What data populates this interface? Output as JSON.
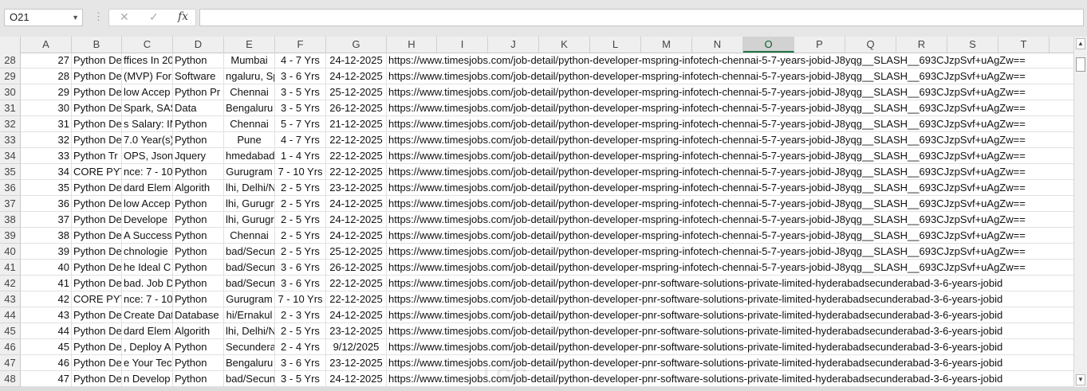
{
  "formula_bar": {
    "name_box": "O21",
    "cancel_icon": "✕",
    "enter_icon": "✓",
    "fx_label": "fx",
    "formula": ""
  },
  "columns": [
    "A",
    "B",
    "C",
    "D",
    "E",
    "F",
    "G",
    "H",
    "I",
    "J",
    "K",
    "L",
    "M",
    "N",
    "O",
    "P",
    "Q",
    "R",
    "S",
    "T"
  ],
  "selected_column": "O",
  "rows": [
    {
      "n": "28",
      "a": "27",
      "b": "Python De",
      "c": "ffices In 20",
      "d": "Python",
      "e": "Mumbai",
      "f": "4 - 7 Yrs",
      "g": "24-12-2025",
      "h": "https://www.timesjobs.com/job-detail/python-developer-mspring-infotech-chennai-5-7-years-jobid-J8yqg__SLASH__693CJzpSvf+uAgZw=="
    },
    {
      "n": "29",
      "a": "28",
      "b": "Python De",
      "c": "(MVP) For",
      "d": "Software",
      "e": "ngaluru, Sp",
      "f": "3 - 6 Yrs",
      "g": "24-12-2025",
      "h": "https://www.timesjobs.com/job-detail/python-developer-mspring-infotech-chennai-5-7-years-jobid-J8yqg__SLASH__693CJzpSvf+uAgZw=="
    },
    {
      "n": "30",
      "a": "29",
      "b": "Python De",
      "c": "low Accep",
      "d": "Python Pr",
      "e": "Chennai",
      "f": "3 - 5 Yrs",
      "g": "25-12-2025",
      "h": "https://www.timesjobs.com/job-detail/python-developer-mspring-infotech-chennai-5-7-years-jobid-J8yqg__SLASH__693CJzpSvf+uAgZw=="
    },
    {
      "n": "31",
      "a": "30",
      "b": "Python De",
      "c": "Spark, SAS",
      "d": "Data",
      "e": "Bengaluru",
      "f": "3 - 5 Yrs",
      "g": "26-12-2025",
      "h": "https://www.timesjobs.com/job-detail/python-developer-mspring-infotech-chennai-5-7-years-jobid-J8yqg__SLASH__693CJzpSvf+uAgZw=="
    },
    {
      "n": "32",
      "a": "31",
      "b": "Python De",
      "c": "s Salary: IN",
      "d": "Python",
      "e": "Chennai",
      "f": "5 - 7 Yrs",
      "g": "21-12-2025",
      "h": "https://www.timesjobs.com/job-detail/python-developer-mspring-infotech-chennai-5-7-years-jobid-J8yqg__SLASH__693CJzpSvf+uAgZw=="
    },
    {
      "n": "33",
      "a": "32",
      "b": "Python De",
      "c": "7.0 Year(s)",
      "d": "Python",
      "e": "Pune",
      "f": "4 - 7 Yrs",
      "g": "22-12-2025",
      "h": "https://www.timesjobs.com/job-detail/python-developer-mspring-infotech-chennai-5-7-years-jobid-J8yqg__SLASH__693CJzpSvf+uAgZw=="
    },
    {
      "n": "34",
      "a": "33",
      "b": "Python Tr",
      "c": "OPS, Json,",
      "d": "Jquery",
      "e": "hmedabad",
      "f": "1 - 4 Yrs",
      "g": "22-12-2025",
      "h": "https://www.timesjobs.com/job-detail/python-developer-mspring-infotech-chennai-5-7-years-jobid-J8yqg__SLASH__693CJzpSvf+uAgZw=="
    },
    {
      "n": "35",
      "a": "34",
      "b": "CORE PYTH",
      "c": "nce: 7 - 10",
      "d": "Python",
      "e": "Gurugram",
      "f": "7 - 10 Yrs",
      "g": "22-12-2025",
      "h": "https://www.timesjobs.com/job-detail/python-developer-mspring-infotech-chennai-5-7-years-jobid-J8yqg__SLASH__693CJzpSvf+uAgZw=="
    },
    {
      "n": "36",
      "a": "35",
      "b": "Python De",
      "c": "dard Elem",
      "d": "Algorith",
      "e": "lhi, Delhi/N",
      "f": "2 - 5 Yrs",
      "g": "23-12-2025",
      "h": "https://www.timesjobs.com/job-detail/python-developer-mspring-infotech-chennai-5-7-years-jobid-J8yqg__SLASH__693CJzpSvf+uAgZw=="
    },
    {
      "n": "37",
      "a": "36",
      "b": "Python De",
      "c": "low Accep",
      "d": "Python",
      "e": "lhi, Gurugr",
      "f": "2 - 5 Yrs",
      "g": "24-12-2025",
      "h": "https://www.timesjobs.com/job-detail/python-developer-mspring-infotech-chennai-5-7-years-jobid-J8yqg__SLASH__693CJzpSvf+uAgZw=="
    },
    {
      "n": "38",
      "a": "37",
      "b": "Python De",
      "c": "Develope",
      "d": "Python",
      "e": "lhi, Gurugr",
      "f": "2 - 5 Yrs",
      "g": "24-12-2025",
      "h": "https://www.timesjobs.com/job-detail/python-developer-mspring-infotech-chennai-5-7-years-jobid-J8yqg__SLASH__693CJzpSvf+uAgZw=="
    },
    {
      "n": "39",
      "a": "38",
      "b": "Python De",
      "c": "A Success",
      "d": "Python",
      "e": "Chennai",
      "f": "2 - 5 Yrs",
      "g": "24-12-2025",
      "h": "https://www.timesjobs.com/job-detail/python-developer-mspring-infotech-chennai-5-7-years-jobid-J8yqg__SLASH__693CJzpSvf+uAgZw=="
    },
    {
      "n": "40",
      "a": "39",
      "b": "Python De",
      "c": "chnologie",
      "d": "Python",
      "e": "bad/Secun",
      "f": "2 - 5 Yrs",
      "g": "25-12-2025",
      "h": "https://www.timesjobs.com/job-detail/python-developer-mspring-infotech-chennai-5-7-years-jobid-J8yqg__SLASH__693CJzpSvf+uAgZw=="
    },
    {
      "n": "41",
      "a": "40",
      "b": "Python De",
      "c": "he Ideal C",
      "d": "Python",
      "e": "bad/Secun",
      "f": "3 - 6 Yrs",
      "g": "26-12-2025",
      "h": "https://www.timesjobs.com/job-detail/python-developer-mspring-infotech-chennai-5-7-years-jobid-J8yqg__SLASH__693CJzpSvf+uAgZw=="
    },
    {
      "n": "42",
      "a": "41",
      "b": "Python De",
      "c": "bad. Job D",
      "d": "Python",
      "e": "bad/Secun",
      "f": "3 - 6 Yrs",
      "g": "22-12-2025",
      "h": "https://www.timesjobs.com/job-detail/python-developer-pnr-software-solutions-private-limited-hyderabadsecunderabad-3-6-years-jobid"
    },
    {
      "n": "43",
      "a": "42",
      "b": "CORE PYTH",
      "c": "nce: 7 - 10",
      "d": "Python",
      "e": "Gurugram",
      "f": "7 - 10 Yrs",
      "g": "22-12-2025",
      "h": "https://www.timesjobs.com/job-detail/python-developer-pnr-software-solutions-private-limited-hyderabadsecunderabad-3-6-years-jobid"
    },
    {
      "n": "44",
      "a": "43",
      "b": "Python De",
      "c": "Create Dat",
      "d": "Database",
      "e": "hi/Ernakul",
      "f": "2 - 3 Yrs",
      "g": "24-12-2025",
      "h": "https://www.timesjobs.com/job-detail/python-developer-pnr-software-solutions-private-limited-hyderabadsecunderabad-3-6-years-jobid"
    },
    {
      "n": "45",
      "a": "44",
      "b": "Python De",
      "c": "dard Elem",
      "d": "Algorith",
      "e": "lhi, Delhi/N",
      "f": "2 - 5 Yrs",
      "g": "23-12-2025",
      "h": "https://www.timesjobs.com/job-detail/python-developer-pnr-software-solutions-private-limited-hyderabadsecunderabad-3-6-years-jobid"
    },
    {
      "n": "46",
      "a": "45",
      "b": "Python De",
      "c": ", Deploy A",
      "d": "Python",
      "e": "Secunderal",
      "f": "2 - 4 Yrs",
      "g": "9/12/2025",
      "h": "https://www.timesjobs.com/job-detail/python-developer-pnr-software-solutions-private-limited-hyderabadsecunderabad-3-6-years-jobid"
    },
    {
      "n": "47",
      "a": "46",
      "b": "Python De",
      "c": "e Your Tec",
      "d": "Python",
      "e": "Bengaluru",
      "f": "3 - 6 Yrs",
      "g": "23-12-2025",
      "h": "https://www.timesjobs.com/job-detail/python-developer-pnr-software-solutions-private-limited-hyderabadsecunderabad-3-6-years-jobid"
    },
    {
      "n": "48",
      "a": "47",
      "b": "Python De",
      "c": "n Develop",
      "d": "Python",
      "e": "bad/Secun",
      "f": "3 - 5 Yrs",
      "g": "24-12-2025",
      "h": "https://www.timesjobs.com/job-detail/python-developer-pnr-software-solutions-private-limited-hyderabadsecunderabad-3-6-years-jobid"
    }
  ],
  "colors": {
    "selected_header_accent": "#217346"
  }
}
